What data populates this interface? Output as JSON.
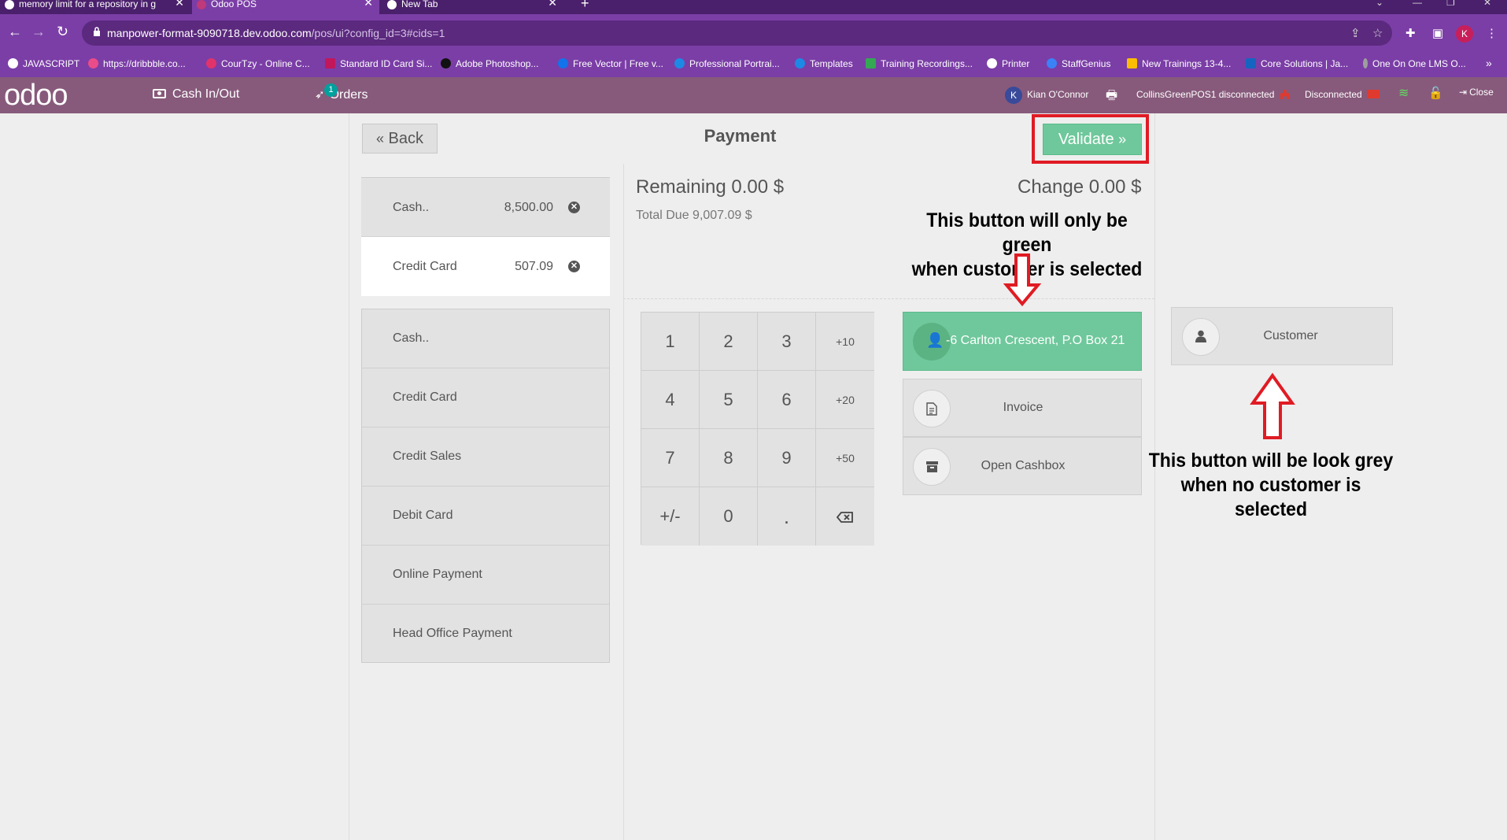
{
  "browser": {
    "tabs": [
      {
        "title": "memory limit for a repository in g",
        "favicon_color": "#ffffff"
      },
      {
        "title": "Odoo POS",
        "favicon_color": "#c0397a"
      },
      {
        "title": "New Tab",
        "favicon_color": "#ffffff"
      }
    ],
    "url_host": "manpower-format-9090718.dev.odoo.com",
    "url_rest": "/pos/ui?config_id=3#cids=1",
    "profile_initial": "K",
    "bookmarks": [
      {
        "label": "JAVASCRIPT",
        "icon_color": "#ffffff"
      },
      {
        "label": "https://dribbble.co...",
        "icon_color": "#ea4c89"
      },
      {
        "label": "CourTzy - Online C...",
        "icon_color": "#e0336b"
      },
      {
        "label": "Standard ID Card Si...",
        "icon_color": "#c2185b"
      },
      {
        "label": "Adobe Photoshop...",
        "icon_color": "#111111"
      },
      {
        "label": "Free Vector | Free v...",
        "icon_color": "#1273eb"
      },
      {
        "label": "Professional Portrai...",
        "icon_color": "#1e88e5"
      },
      {
        "label": "Templates",
        "icon_color": "#1e88e5"
      },
      {
        "label": "Training Recordings...",
        "icon_color": "#34a853"
      },
      {
        "label": "Printer",
        "icon_color": "#ffffff"
      },
      {
        "label": "StaffGenius",
        "icon_color": "#3b82f6"
      },
      {
        "label": "New Trainings 13-4...",
        "icon_color": "#fbbc04"
      },
      {
        "label": "Core Solutions | Ja...",
        "icon_color": "#1565c0"
      },
      {
        "label": "One On One LMS O...",
        "icon_color": "#9e9e9e"
      }
    ]
  },
  "header": {
    "logo": "odoo",
    "cash_in_out": "Cash In/Out",
    "orders": "Orders",
    "orders_badge": "1",
    "user_initial": "K",
    "user_name": "Kian O'Connor",
    "printer_status": "CollinsGreenPOS1 disconnected",
    "connection_status": "Disconnected",
    "close": "Close"
  },
  "payment": {
    "back_label": "Back",
    "title": "Payment",
    "validate_label": "Validate",
    "lines": [
      {
        "method": "Cash..",
        "amount": "8,500.00"
      },
      {
        "method": "Credit Card",
        "amount": "507.09"
      }
    ],
    "methods": [
      "Cash..",
      "Credit Card",
      "Credit Sales",
      "Debit Card",
      "Online Payment",
      "Head Office Payment"
    ],
    "remaining": "Remaining 0.00 $",
    "total_due": "Total Due  9,007.09 $",
    "change": "Change 0.00 $",
    "numpad": [
      "1",
      "2",
      "3",
      "+10",
      "4",
      "5",
      "6",
      "+20",
      "7",
      "8",
      "9",
      "+50",
      "+/-",
      "0",
      "."
    ],
    "customer_selected": "-6 Carlton Crescent, P.O Box 21",
    "invoice": "Invoice",
    "open_cashbox": "Open Cashbox",
    "customer": "Customer"
  },
  "annotations": {
    "green_note_line1": "This button will only be green",
    "green_note_line2": "when customer is selected",
    "grey_note_line1": "This button will be look grey",
    "grey_note_line2": "when no customer is selected"
  },
  "colors": {
    "browser_purple": "#7a3ea6",
    "odoo_header": "#875a7b",
    "validate_green": "#6ec89b",
    "annotation_red": "#e01b24"
  }
}
